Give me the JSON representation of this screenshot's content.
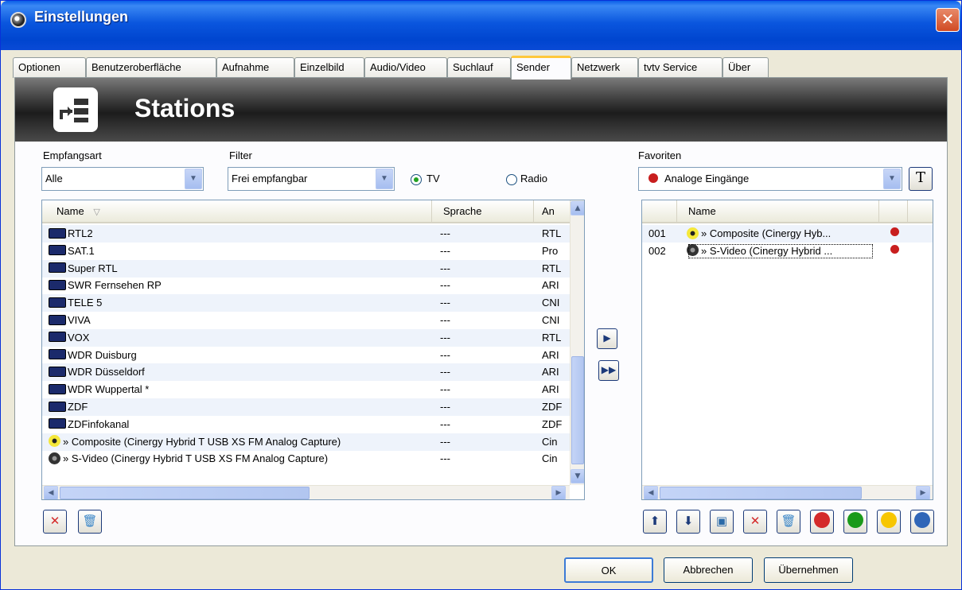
{
  "window": {
    "title": "Einstellungen"
  },
  "tabs": [
    "Optionen",
    "Benutzeroberfläche",
    "Aufnahme",
    "Einzelbild",
    "Audio/Video",
    "Suchlauf",
    "Sender",
    "Netzwerk",
    "tvtv Service",
    "Über"
  ],
  "active_tab": "Sender",
  "banner": {
    "title": "Stations"
  },
  "left": {
    "empfangsart_label": "Empfangsart",
    "empfangsart_value": "Alle",
    "filter_label": "Filter",
    "filter_value": "Frei empfangbar",
    "radio_tv": "TV",
    "radio_radio": "Radio",
    "columns": [
      "Name",
      "Sprache",
      "An"
    ],
    "rows": [
      {
        "name": "RTL2",
        "lang": "---",
        "an": "RTL",
        "icon": "tv"
      },
      {
        "name": "SAT.1",
        "lang": "---",
        "an": "Pro",
        "icon": "tv"
      },
      {
        "name": "Super RTL",
        "lang": "---",
        "an": "RTL",
        "icon": "tv"
      },
      {
        "name": "SWR Fernsehen RP",
        "lang": "---",
        "an": "ARI",
        "icon": "tv"
      },
      {
        "name": "TELE 5",
        "lang": "---",
        "an": "CNI",
        "icon": "tv"
      },
      {
        "name": "VIVA",
        "lang": "---",
        "an": "CNI",
        "icon": "tv"
      },
      {
        "name": "VOX",
        "lang": "---",
        "an": "RTL",
        "icon": "tv"
      },
      {
        "name": "WDR Duisburg",
        "lang": "---",
        "an": "ARI",
        "icon": "tv"
      },
      {
        "name": "WDR Düsseldorf",
        "lang": "---",
        "an": "ARI",
        "icon": "tv"
      },
      {
        "name": "WDR Wuppertal *",
        "lang": "---",
        "an": "ARI",
        "icon": "tv"
      },
      {
        "name": "ZDF",
        "lang": "---",
        "an": "ZDF",
        "icon": "tv"
      },
      {
        "name": "ZDFinfokanal",
        "lang": "---",
        "an": "ZDF",
        "icon": "tv"
      },
      {
        "name": "» Composite (Cinergy Hybrid T USB XS FM Analog Capture)",
        "lang": "---",
        "an": "Cin",
        "icon": "composite"
      },
      {
        "name": "» S-Video (Cinergy Hybrid T USB XS FM Analog Capture)",
        "lang": "---",
        "an": "Cin",
        "icon": "svideo"
      }
    ]
  },
  "right": {
    "favoriten_label": "Favoriten",
    "favoriten_value": "Analoge Eingänge",
    "columns": [
      "Name"
    ],
    "rows": [
      {
        "num": "001",
        "name": "» Composite (Cinergy Hyb...",
        "icon": "composite"
      },
      {
        "num": "002",
        "name": "» S-Video (Cinergy Hybrid ...",
        "icon": "svideo"
      }
    ],
    "color_buttons": [
      "#d42a2a",
      "#1a9a1a",
      "#f7c600",
      "#3066b8"
    ]
  },
  "buttons": {
    "ok": "OK",
    "cancel": "Abbrechen",
    "apply": "Übernehmen"
  }
}
